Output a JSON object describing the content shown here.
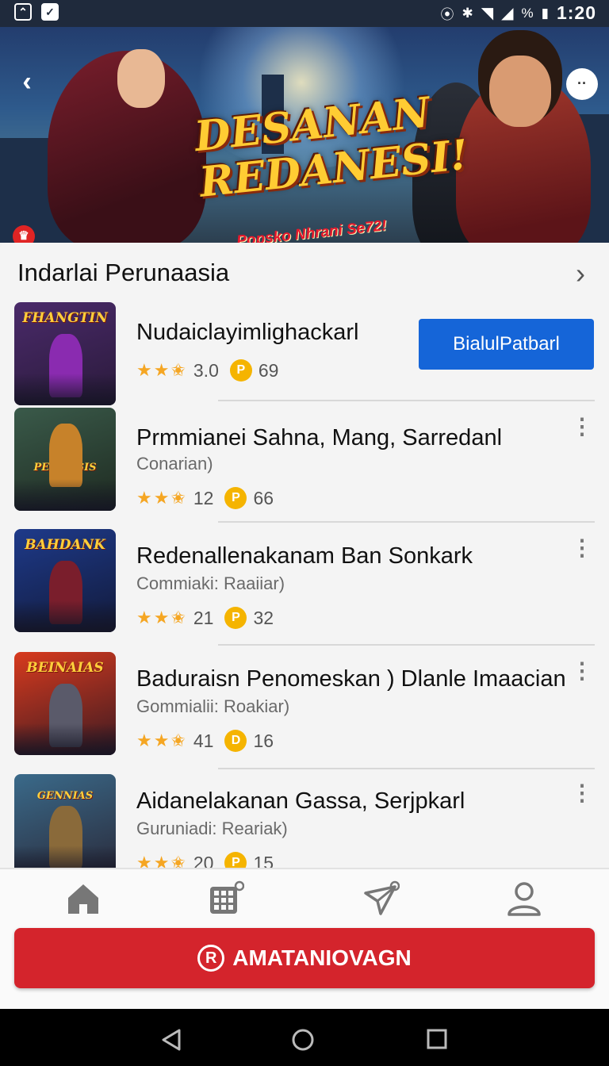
{
  "status_bar": {
    "time": "1:20",
    "battery": "%"
  },
  "banner": {
    "title_line1": "DESANAN",
    "title_line2": "REDANESI!",
    "subtitle": "Popsko Nhrani Se72!"
  },
  "section": {
    "title": "Indarlai Perunaasia"
  },
  "games": [
    {
      "thumb_label": "FHANGTIN",
      "title": "Nudaiclayimlighackarl",
      "subtitle": "",
      "rating": "3.0",
      "coins": "69",
      "action_label": "BialulPatbarl",
      "accent": "#8a2bb0"
    },
    {
      "thumb_label": "PERANGIS",
      "title": "Prmmianei Sahna, Mang, Sarredanl",
      "subtitle": "Conarian)",
      "rating": "12",
      "coins": "66",
      "accent": "#c7822a"
    },
    {
      "thumb_label": "BAHDANK",
      "title": "Redenallenakanam Ban Sonkark",
      "subtitle": "Commiaki: Raaiiar)",
      "rating": "21",
      "coins": "32",
      "accent": "#2a4ac7"
    },
    {
      "thumb_label": "BEINAIAS",
      "title": "Baduraisn Penomeskan ) Dlanle Imaacian",
      "subtitle": "Gommialii: Roakiar)",
      "rating": "41",
      "coins": "16",
      "accent": "#d8401e"
    },
    {
      "thumb_label": "GENNIAS",
      "title": "Aidanelakanan Gassa, Serjpkarl",
      "subtitle": "Guruniadi: Reariak)",
      "rating": "20",
      "coins": "15",
      "accent": "#3a8fc7"
    }
  ],
  "bottom_nav": {
    "items": [
      "home-icon",
      "grid-icon",
      "send-icon",
      "profile-icon"
    ],
    "cta_label": "AMATANIOVAGN"
  },
  "colors": {
    "primary": "#1565d8",
    "cta": "#d4242c",
    "star": "#f5a623",
    "coin": "#f5b400"
  }
}
